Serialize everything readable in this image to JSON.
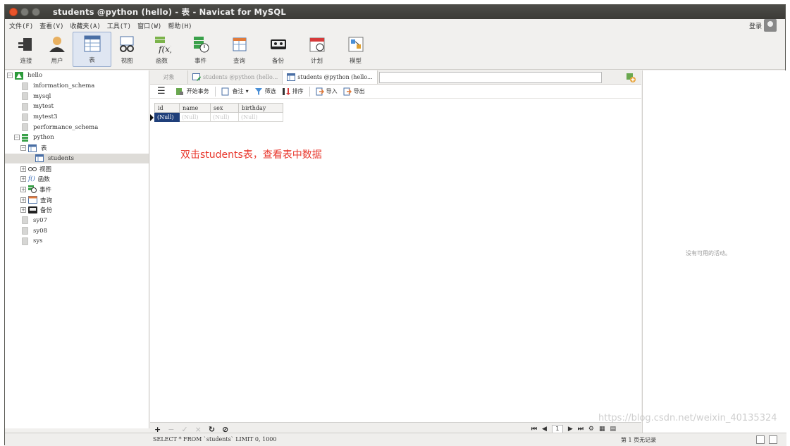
{
  "window": {
    "title": "students @python (hello) - 表 - Navicat for MySQL"
  },
  "menu": {
    "items": [
      "文件(F)",
      "查看(V)",
      "收藏夹(A)",
      "工具(T)",
      "窗口(W)",
      "帮助(H)"
    ],
    "login": "登录"
  },
  "toolbar": {
    "buttons": [
      {
        "label": "连接",
        "icon": "plug-icon"
      },
      {
        "label": "用户",
        "icon": "user-icon"
      },
      {
        "label": "表",
        "icon": "table-icon",
        "active": true
      },
      {
        "label": "视图",
        "icon": "glasses-icon"
      },
      {
        "label": "函数",
        "icon": "function-icon"
      },
      {
        "label": "事件",
        "icon": "event-icon"
      },
      {
        "label": "查询",
        "icon": "query-icon"
      },
      {
        "label": "备份",
        "icon": "backup-icon"
      },
      {
        "label": "计划",
        "icon": "schedule-icon"
      },
      {
        "label": "模型",
        "icon": "model-icon"
      }
    ]
  },
  "tree": {
    "connection": "hello",
    "databases": [
      "information_schema",
      "mysql",
      "mytest",
      "mytest3",
      "performance_schema"
    ],
    "active_db": "python",
    "tables_node": "表",
    "selected_table": "students",
    "sub_nodes": [
      {
        "label": "视图",
        "icon": "glasses-icon"
      },
      {
        "label": "函数",
        "icon": "function-icon"
      },
      {
        "label": "事件",
        "icon": "event-icon"
      },
      {
        "label": "查询",
        "icon": "query-icon"
      },
      {
        "label": "备份",
        "icon": "backup-icon"
      }
    ],
    "other_dbs": [
      "sy07",
      "sy08",
      "sys"
    ]
  },
  "tabs": {
    "objects": "对象",
    "tab1": "students @python (hello...",
    "tab2": "students @python (hello..."
  },
  "subtoolbar": {
    "begin_txn": "开始事务",
    "memo": "备注",
    "filter": "筛选",
    "sort": "排序",
    "import": "导入",
    "export": "导出"
  },
  "grid": {
    "columns": [
      "id",
      "name",
      "sex",
      "birthday"
    ],
    "rows": [
      [
        "(Null)",
        "(Null)",
        "(Null)",
        "(Null)"
      ]
    ]
  },
  "annotation": "双击students表，查看表中数据",
  "pager": {
    "page": "1"
  },
  "status": {
    "sql": "SELECT * FROM `students` LIMIT 0, 1000",
    "records": "第 1 页无记录"
  },
  "right_pane": {
    "empty_text": "没有可用的活动。"
  },
  "watermark": "https://blog.csdn.net/weixin_40135324",
  "colors": {
    "accent": "#1f3f7a",
    "annotation": "#e8362b",
    "close": "#e9542b"
  }
}
